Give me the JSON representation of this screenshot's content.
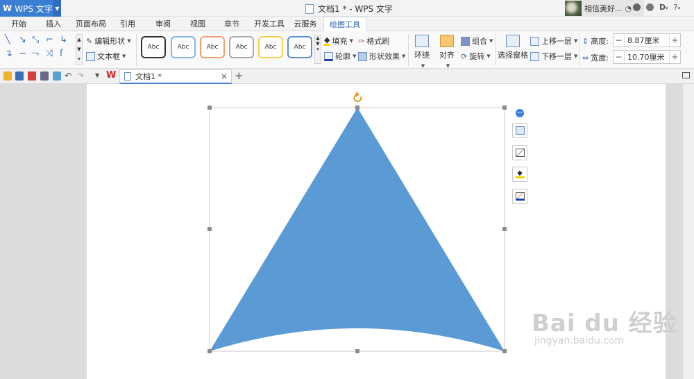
{
  "app": {
    "logo": "W",
    "name": "WPS 文字",
    "window_title": "文档1 * - WPS 文字",
    "user_name": "相信美好...",
    "help": "?"
  },
  "menu_tabs": [
    "开始",
    "插入",
    "页面布局",
    "引用",
    "审阅",
    "视图",
    "章节",
    "开发工具",
    "云服务",
    "绘图工具"
  ],
  "ribbon": {
    "edit_shape": "编辑形状",
    "text_box": "文本框",
    "style_samples": [
      "Abc",
      "Abc",
      "Abc",
      "Abc",
      "Abc",
      "Abc"
    ],
    "fill": "填充",
    "format_painter": "格式刷",
    "outline": "轮廓",
    "shape_effects": "形状效果",
    "wrap": "环绕",
    "align": "对齐",
    "group": "组合",
    "rotate": "旋转",
    "selection_pane": "选择窗格",
    "bring_forward": "上移一层",
    "send_backward": "下移一层",
    "height_label": "高度:",
    "height_value": "8.87厘米",
    "width_label": "宽度:",
    "width_value": "10.70厘米",
    "minus": "−",
    "plus": "+"
  },
  "document_tab": {
    "title": "文档1 *",
    "close": "×",
    "new_tab": "+"
  },
  "shape": {
    "fill_color": "#5b9bd5",
    "handle_color": "#8c8c8c",
    "rotate_handle_color": "#e8952c"
  },
  "side_tools": [
    "layout-options-icon",
    "shape-outline-icon",
    "shape-fill-icon",
    "line-style-icon"
  ],
  "collapse": "−",
  "watermark": {
    "main": "Bai du 经验",
    "sub": "jingyan.baidu.com"
  }
}
